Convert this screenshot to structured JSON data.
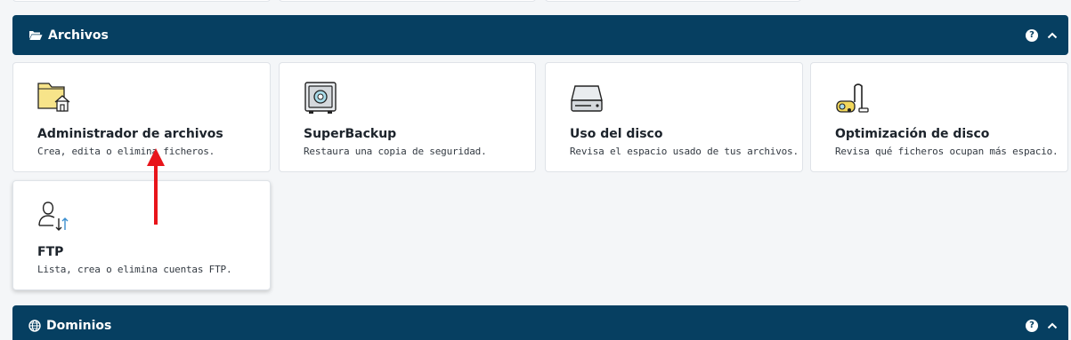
{
  "sections": {
    "files": {
      "title": "Archivos",
      "help": "?"
    },
    "domains": {
      "title": "Dominios",
      "help": "?"
    }
  },
  "cards": [
    {
      "title": "Administrador de archivos",
      "desc": "Crea, edita o elimina ficheros.",
      "icon": "folder-home-icon"
    },
    {
      "title": "SuperBackup",
      "desc": "Restaura una copia de seguridad.",
      "icon": "safe-icon"
    },
    {
      "title": "Uso del disco",
      "desc": "Revisa el espacio usado de tus archivos.",
      "icon": "hard-disk-icon"
    },
    {
      "title": "Optimización de disco",
      "desc": "Revisa qué ficheros ocupan más espacio.",
      "icon": "vacuum-cleaner-icon"
    },
    {
      "title": "FTP",
      "desc": "Lista, crea o elimina cuentas FTP.",
      "icon": "user-transfer-icon"
    }
  ],
  "colors": {
    "bar": "#063f61",
    "arrow": "#e8141a"
  }
}
